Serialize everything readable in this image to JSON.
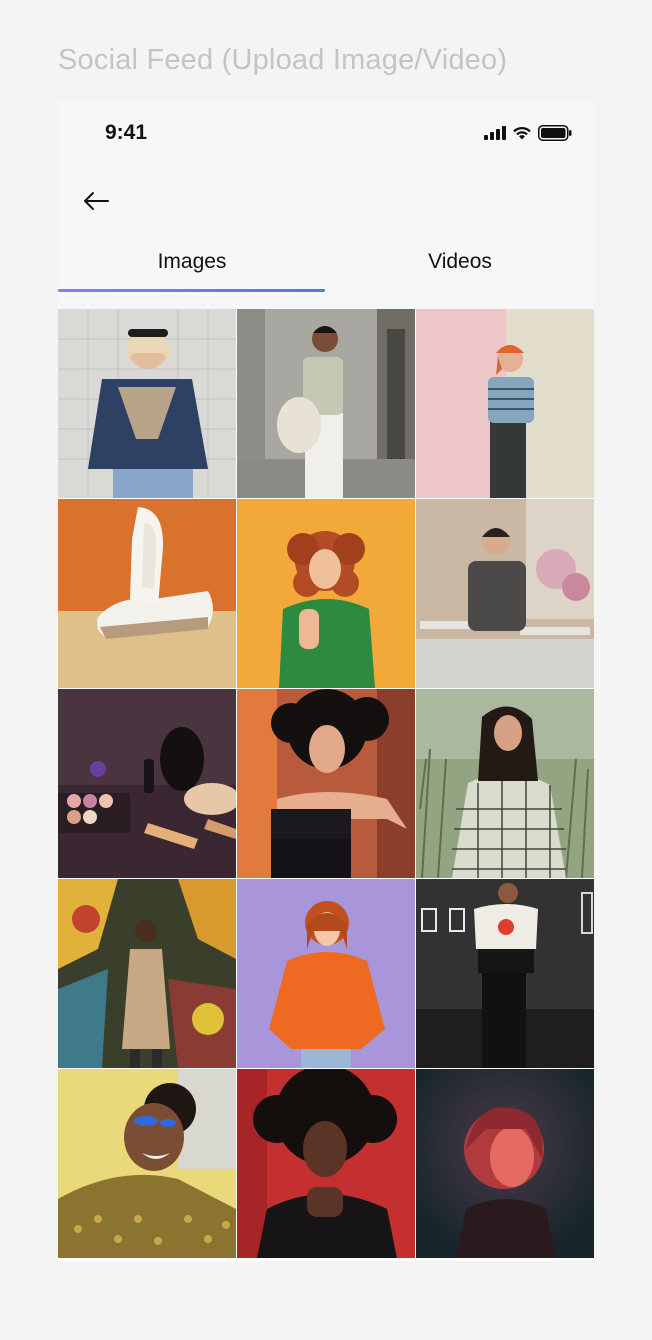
{
  "page": {
    "caption": "Social Feed (Upload Image/Video)"
  },
  "status_bar": {
    "time": "9:41"
  },
  "tabs": [
    {
      "label": "Images",
      "active": true
    },
    {
      "label": "Videos",
      "active": false
    }
  ],
  "icons": {
    "back": "arrow-left-icon",
    "signal": "cellular-signal-icon",
    "wifi": "wifi-icon",
    "battery": "battery-icon"
  },
  "colors": {
    "tab_indicator_start": "#8a7ee8",
    "tab_indicator_end": "#4f7bd6"
  },
  "gallery": [
    {
      "subject": "woman in blue and beige sweater against white brick wall"
    },
    {
      "subject": "woman with tote bag in white pants"
    },
    {
      "subject": "woman with orange beanie against pink and beige wall"
    },
    {
      "subject": "white sneaker on orange background"
    },
    {
      "subject": "curly-haired woman in green top on orange background"
    },
    {
      "subject": "person seated in cafe with flowers"
    },
    {
      "subject": "makeup products on dark purple surface"
    },
    {
      "subject": "woman in black strapless top on orange background"
    },
    {
      "subject": "woman in checkered dress in field of grass"
    },
    {
      "subject": "person in trench coat in front of graffiti wall"
    },
    {
      "subject": "woman in orange hoodie on lavender background"
    },
    {
      "subject": "person in graphic t-shirt on dark street"
    },
    {
      "subject": "laughing woman with blue eyeshadow in sequin top"
    },
    {
      "subject": "woman with afro in black blazer on red background"
    },
    {
      "subject": "woman in red neon light on dark background"
    }
  ]
}
